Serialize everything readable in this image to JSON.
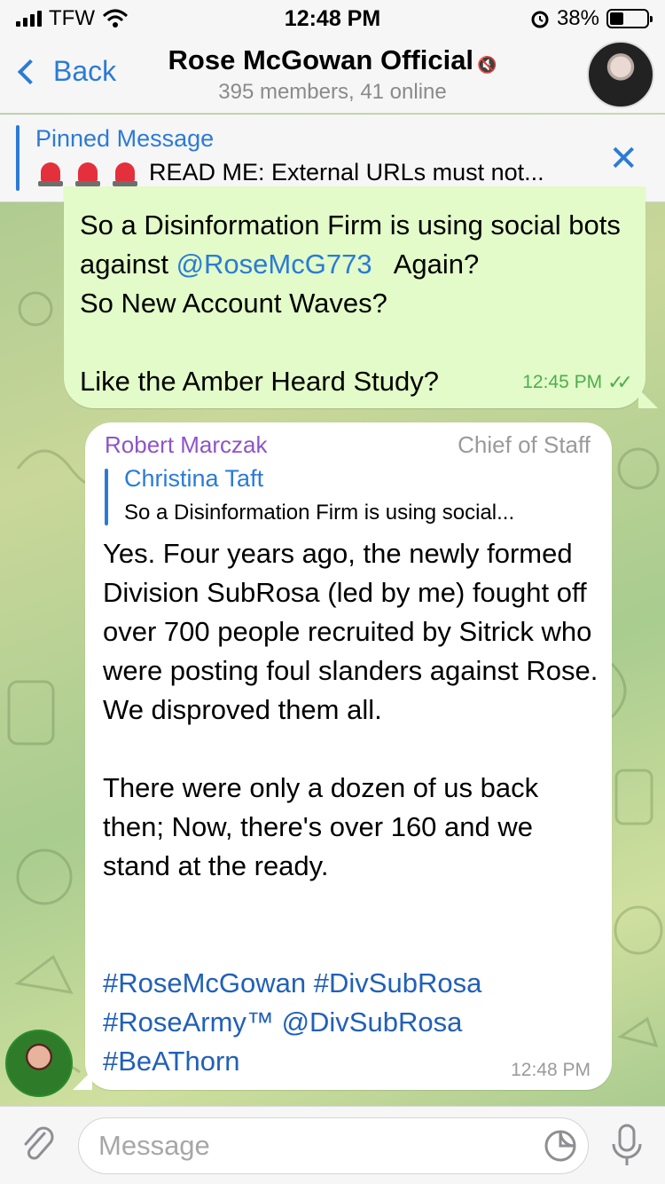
{
  "status_bar": {
    "carrier": "TFW",
    "time": "12:48 PM",
    "battery": "38%",
    "battery_level": 0.38
  },
  "header": {
    "back_label": "Back",
    "title": "Rose McGowan Official",
    "subtitle": "395 members, 41 online",
    "muted_icon": "speaker-muted-icon"
  },
  "pinned": {
    "title": "Pinned Message",
    "text": "READ ME: External URLs must not...",
    "emoji_icon": "siren-icon"
  },
  "messages": {
    "outgoing": {
      "line1": "So a Disinformation Firm is using social bots against ",
      "mention": "@RoseMcG773",
      "line2": "   Again?\nSo New Account Waves?\n\nLike the Amber Heard Study?",
      "time": "12:45 PM"
    },
    "incoming": {
      "sender": "Robert Marczak",
      "role": "Chief of Staff",
      "reply_name": "Christina Taft",
      "reply_text": "So a Disinformation Firm is using social...",
      "body": "Yes. Four years ago, the newly formed Division SubRosa (led by me) fought off over 700 people recruited by Sitrick who were posting foul slanders against Rose. We disproved them all.\n\nThere were only a dozen of us back then; Now, there's over 160 and we stand at the ready.",
      "tag1": "#RoseMcGowan",
      "tag2": "#DivSubRosa",
      "tag3": "#RoseArmy™",
      "tag4": "@DivSubRosa",
      "tag5": "#BeAThorn",
      "time": "12:48 PM"
    }
  },
  "input": {
    "placeholder": "Message"
  },
  "colors": {
    "accent": "#2b7bd6",
    "outgoing_bubble": "#e2fbc8",
    "read_ticks": "#4fae4e",
    "sender_name": "#8d55c8"
  }
}
